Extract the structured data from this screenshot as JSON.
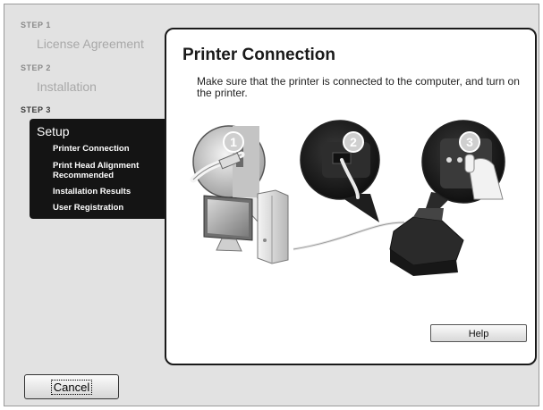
{
  "sidebar": {
    "step1": {
      "label": "STEP 1",
      "title": "License Agreement"
    },
    "step2": {
      "label": "STEP 2",
      "title": "Installation"
    },
    "step3": {
      "label": "STEP 3",
      "title": "Setup",
      "items": [
        "Printer Connection",
        "Print Head Alignment Recommended",
        "Installation Results",
        "User Registration"
      ]
    }
  },
  "main": {
    "title": "Printer Connection",
    "description": "Make sure that the printer is connected to the computer, and turn on the printer.",
    "illustration": {
      "badges": [
        "1",
        "2",
        "3"
      ]
    },
    "help_label": "Help"
  },
  "footer": {
    "cancel_label": "Cancel"
  },
  "colors": {
    "setup_bg": "#141414",
    "panel_border": "#1a1a1a",
    "window_bg": "#e2e2e2"
  }
}
